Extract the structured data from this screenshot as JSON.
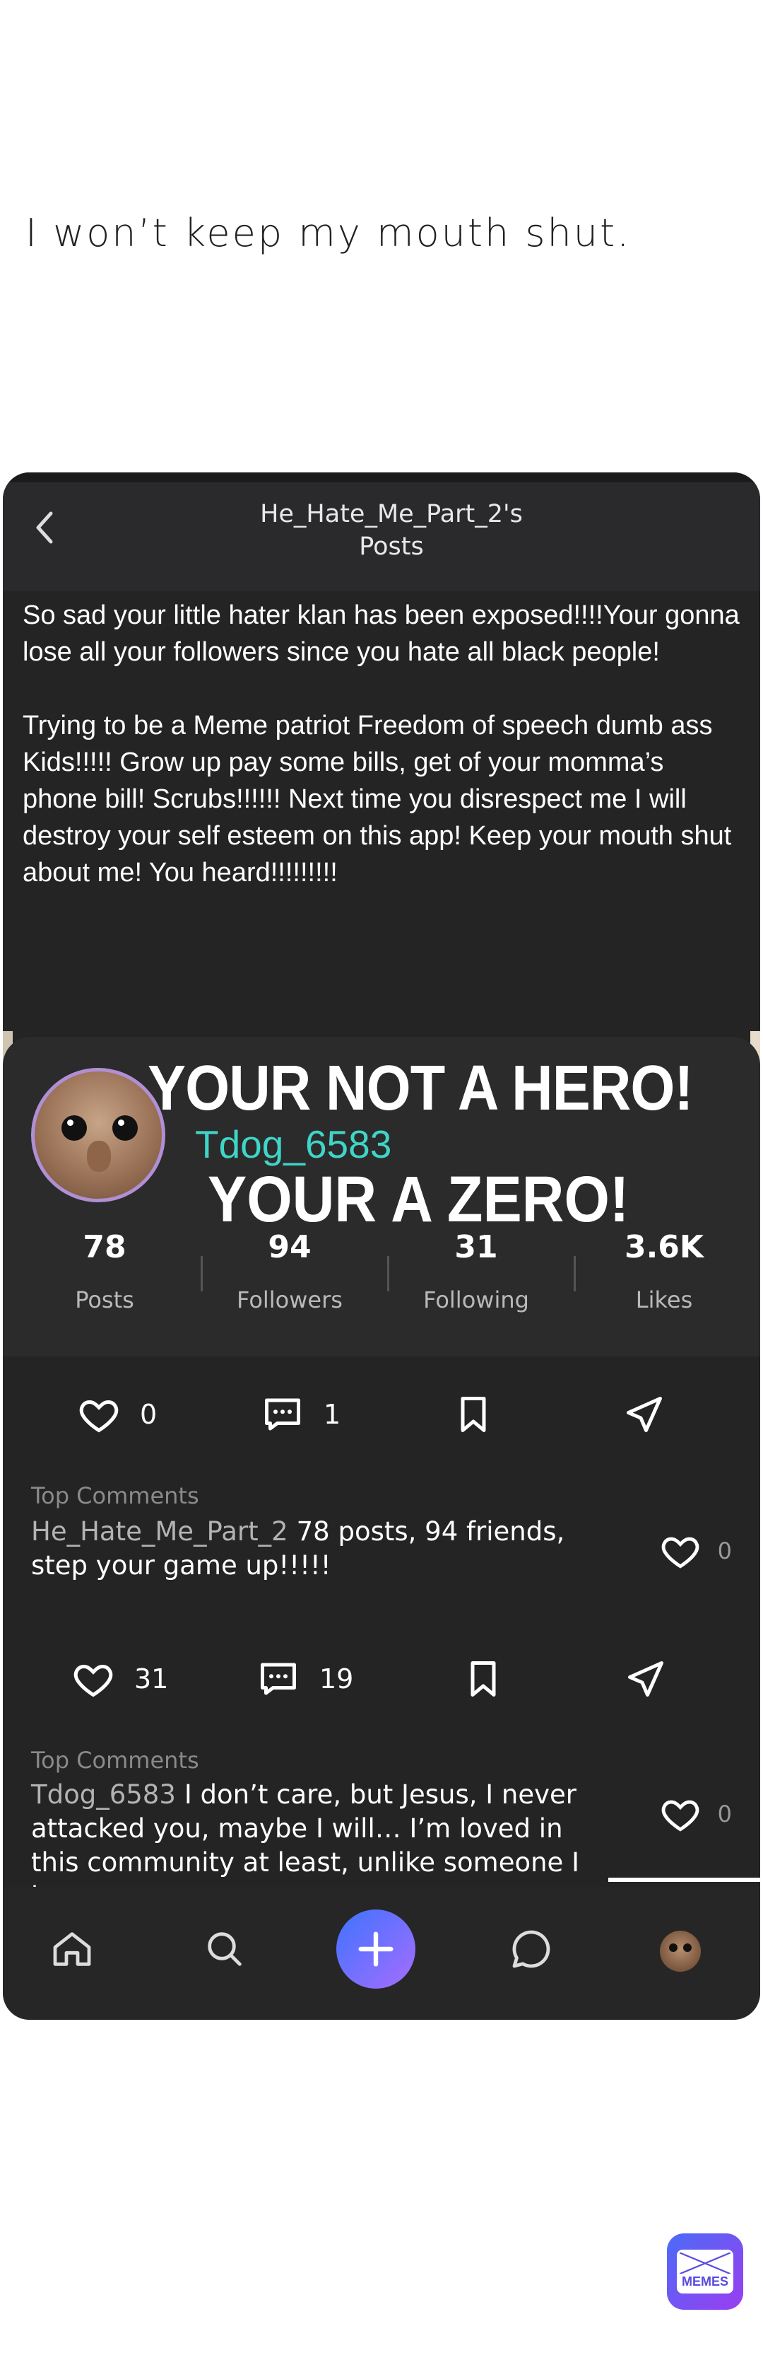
{
  "caption": "I won’t keep my mouth shut.",
  "header": {
    "title_line1": "He_Hate_Me_Part_2's",
    "title_line2": "Posts"
  },
  "post": {
    "paragraph1": "So sad your little hater klan has been exposed!!!!Your gonna lose all your followers since you hate all black people!",
    "paragraph2": "Trying to be a Meme patriot Freedom of speech dumb ass Kids!!!!! Grow up pay some bills, get of your momma’s phone bill! Scrubs!!!!!! Next time you disrespect me I will destroy your self esteem on this app! Keep your mouth shut about me! You heard!!!!!!!!!"
  },
  "profile": {
    "headline1": "YOUR NOT A HERO!",
    "username": "Tdog_6583",
    "headline2": "YOUR A ZERO!",
    "stats": [
      {
        "value": "78",
        "label": "Posts"
      },
      {
        "value": "94",
        "label": "Followers"
      },
      {
        "value": "31",
        "label": "Following"
      },
      {
        "value": "3.6K",
        "label": "Likes"
      }
    ]
  },
  "feed": [
    {
      "likes": "0",
      "comments": "1",
      "top_comments_label": "Top Comments",
      "comment_user": "He_Hate_Me_Part_2",
      "comment_text": "78 posts, 94 friends, step your game up!!!!!",
      "comment_likes": "0"
    },
    {
      "likes": "31",
      "comments": "19",
      "top_comments_label": "Top Comments",
      "comment_user": "Tdog_6583",
      "comment_text": "I don’t care, but Jesus, I never attacked you, maybe I will… I’m loved in this community at least, unlike someone I know",
      "comment_likes": "0"
    }
  ],
  "tabbar": {
    "items": [
      "home-icon",
      "search-icon",
      "add-icon",
      "chat-icon",
      "profile-avatar"
    ]
  },
  "watermark": {
    "label": "MEMES"
  },
  "colors": {
    "accent": "#3fd5c8",
    "plus_gradient_start": "#3e73ff",
    "plus_gradient_end": "#a66dff"
  }
}
